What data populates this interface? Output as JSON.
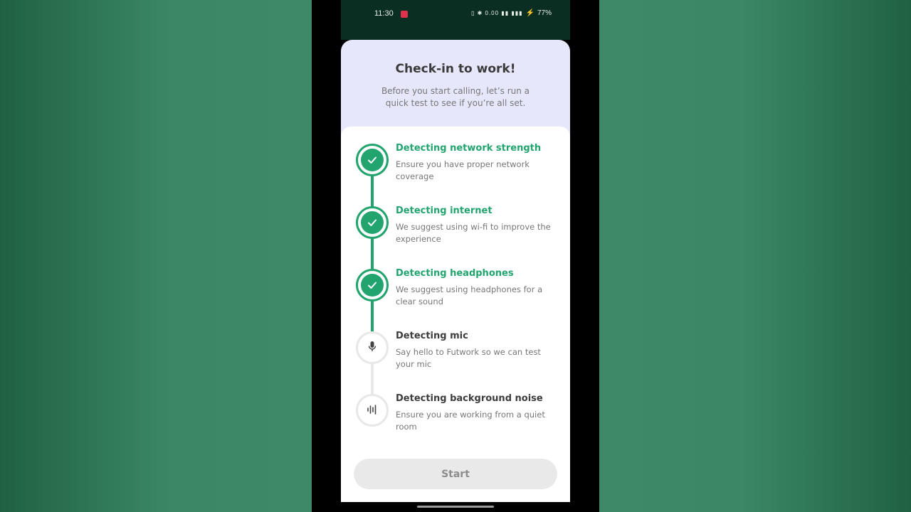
{
  "status_bar": {
    "time": "11:30",
    "icons": "▯ ✱ 0.00 ▮▮ ▮▮▮",
    "battery": "77%"
  },
  "header": {
    "title": "Check-in to work!",
    "subtitle": "Before you start calling, let’s run a quick test to see if you’re all set."
  },
  "steps": [
    {
      "title": "Detecting network strength",
      "description": "Ensure you have proper network coverage",
      "status": "done",
      "icon": "check-icon"
    },
    {
      "title": "Detecting internet",
      "description": "We suggest using wi-fi to improve the experience",
      "status": "done",
      "icon": "check-icon"
    },
    {
      "title": "Detecting headphones",
      "description": "We suggest using headphones for a clear sound",
      "status": "done",
      "icon": "check-icon"
    },
    {
      "title": "Detecting mic",
      "description": "Say hello to Futwork so we can test your mic",
      "status": "pending",
      "icon": "microphone-icon"
    },
    {
      "title": "Detecting background noise",
      "description": "Ensure you are working from a quiet room",
      "status": "pending",
      "icon": "sound-wave-icon"
    }
  ],
  "actions": {
    "start_label": "Start"
  },
  "colors": {
    "accent": "#22a46e",
    "pending": "#e8e8e8",
    "header_bg": "#e6e7fb"
  }
}
